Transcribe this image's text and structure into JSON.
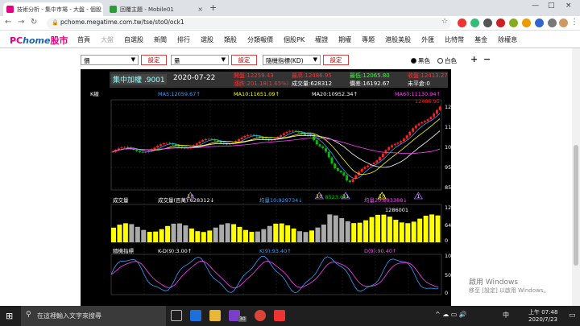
{
  "browser": {
    "tabs": [
      {
        "title": "技術分析 - 集中市場 - 大盤 - 個股",
        "close": "×"
      },
      {
        "title": "回覆主題 - Mobile01",
        "close": "×"
      }
    ],
    "new_tab": "+",
    "url": "pchome.megatime.com.tw/tse/sto0/ock1",
    "window_controls": [
      "—",
      "□",
      "×"
    ]
  },
  "site": {
    "logo_p": "PC",
    "logo_home": "home",
    "logo_stock": "股市",
    "menu": [
      "首頁",
      "大盤",
      "自選股",
      "新聞",
      "排行",
      "選股",
      "類股",
      "分類報價",
      "個股PK",
      "權證",
      "期權",
      "專題",
      "港股美股",
      "外匯",
      "比特幣",
      "基金",
      "除權息"
    ],
    "menu_current": "大盤"
  },
  "controls": {
    "select1": "價",
    "select2": "量",
    "select3": "隨機指標(KD)",
    "set_label": "設定",
    "radio_black": "黑色",
    "radio_white": "白色",
    "plus": "+",
    "minus": "−"
  },
  "info": {
    "name": "集中加權 .9001",
    "date": "2020-07-22",
    "open_label": "開盤:",
    "open": "12259.43",
    "high_label": "最高:",
    "high": "12486.95",
    "low_label": "最低:",
    "low": "12065.80",
    "close_label": "收盤:",
    "close": "12413.27",
    "change_label": "漲跌:",
    "change": "201.18(1.65%)",
    "volume_label": "成交量:",
    "volume": "628312",
    "price_label": "價差:",
    "price_diff": "16192.67",
    "pending_label": "未平倉:",
    "pending": "0"
  },
  "price_panel": {
    "tag": "K線",
    "ma5": "MA5:12059.67↑",
    "ma10": "MA10:11651.09↑",
    "ma20": "MA20:10952.34↑",
    "ma60": "MA60:11130.94↑",
    "axis": [
      "12486.95",
      "11496.12",
      "10505.29",
      "9514.46",
      "8523.63"
    ],
    "high_marker": "12486.95",
    "low_marker": "8523.63",
    "tri_labels": [
      "10",
      "10",
      "11",
      "10",
      "1"
    ]
  },
  "volume_panel": {
    "tag": "成交量",
    "vol": "成交量(百萬):628312↓",
    "avg5": "均量10:929734↓",
    "avg20": "均量20:693388↓",
    "axis": [
      "1290000",
      "645000",
      "0"
    ],
    "peak": "1286001"
  },
  "kd_panel": {
    "tag": "隨機指標",
    "kd": "K-D(9):3.00↑",
    "k": "K(9):93.40↑",
    "d": "D(9):90.40↑",
    "axis": [
      "100",
      "50",
      "0"
    ]
  },
  "colors": {
    "up": "#ff2020",
    "down": "#00c000",
    "ma5": "#33a0ff",
    "ma10": "#ffff00",
    "ma20": "#ffffff",
    "ma60": "#ff40ff",
    "vol_up": "#ffff00",
    "vol_down": "#aaaaaa"
  },
  "taskbar": {
    "search": "在這裡輸入文字來搜尋",
    "ime": "中",
    "time": "上午 07:48",
    "date": "2020/7/23",
    "badge": "30"
  },
  "watermark": {
    "line1": "啟用 Windows",
    "line2": "移至 [設定] 以啟用 Windows。"
  }
}
